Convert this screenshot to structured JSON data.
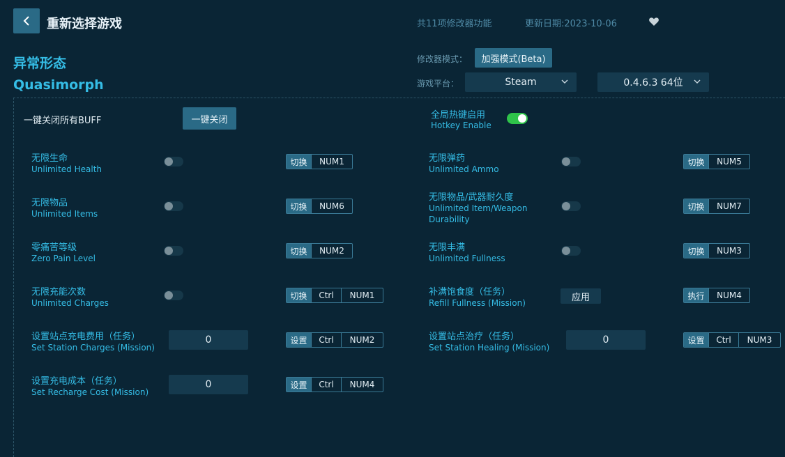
{
  "header": {
    "back_icon": "chevron-left-icon",
    "title": "重新选择游戏",
    "feature_count": "共11项修改器功能",
    "update_date": "更新日期:2023-10-06",
    "favorite_icon": "heart-icon"
  },
  "game": {
    "name_cn": "异常形态",
    "name_en": "Quasimorph"
  },
  "settings": {
    "mode_label": "修改器模式：",
    "mode_value": "加强模式(Beta)",
    "platform_label": "游戏平台：",
    "platform_value": "Steam",
    "version_value": "0.4.6.3 64位"
  },
  "controls": {
    "all_off_label": "一键关闭所有BUFF",
    "all_off_button": "一键关闭",
    "hotkey_cn": "全局热键启用",
    "hotkey_en": "Hotkey Enable",
    "hotkey_enabled": true
  },
  "options": [
    {
      "cn": "无限生命",
      "en": "Unlimited Health",
      "action": "切换",
      "keys": [
        "NUM1"
      ]
    },
    {
      "cn": "无限弹药",
      "en": "Unlimited Ammo",
      "action": "切换",
      "keys": [
        "NUM5"
      ]
    },
    {
      "cn": "无限物品",
      "en": "Unlimited Items",
      "action": "切换",
      "keys": [
        "NUM6"
      ]
    },
    {
      "cn": "无限物品/武器耐久度",
      "en": "Unlimited Item/Weapon Durability",
      "action": "切换",
      "keys": [
        "NUM7"
      ]
    },
    {
      "cn": "零痛苦等级",
      "en": "Zero Pain Level",
      "action": "切换",
      "keys": [
        "NUM2"
      ]
    },
    {
      "cn": "无限丰满",
      "en": "Unlimited Fullness",
      "action": "切换",
      "keys": [
        "NUM3"
      ]
    },
    {
      "cn": "无限充能次数",
      "en": "Unlimited Charges",
      "action": "切换",
      "keys": [
        "Ctrl",
        "NUM1"
      ]
    },
    {
      "cn": "补满饱食度（任务）",
      "en": "Refill Fullness (Mission)",
      "button": "应用",
      "action": "执行",
      "keys": [
        "NUM4"
      ]
    },
    {
      "cn": "设置站点充电费用（任务）",
      "en": "Set Station Charges (Mission)",
      "value": "0",
      "action": "设置",
      "keys": [
        "Ctrl",
        "NUM2"
      ]
    },
    {
      "cn": "设置站点治疗（任务）",
      "en": "Set Station Healing (Mission)",
      "value": "0",
      "action": "设置",
      "keys": [
        "Ctrl",
        "NUM3"
      ]
    },
    {
      "cn": "设置充电成本（任务）",
      "en": "Set Recharge Cost (Mission)",
      "value": "0",
      "action": "设置",
      "keys": [
        "Ctrl",
        "NUM4"
      ]
    }
  ]
}
